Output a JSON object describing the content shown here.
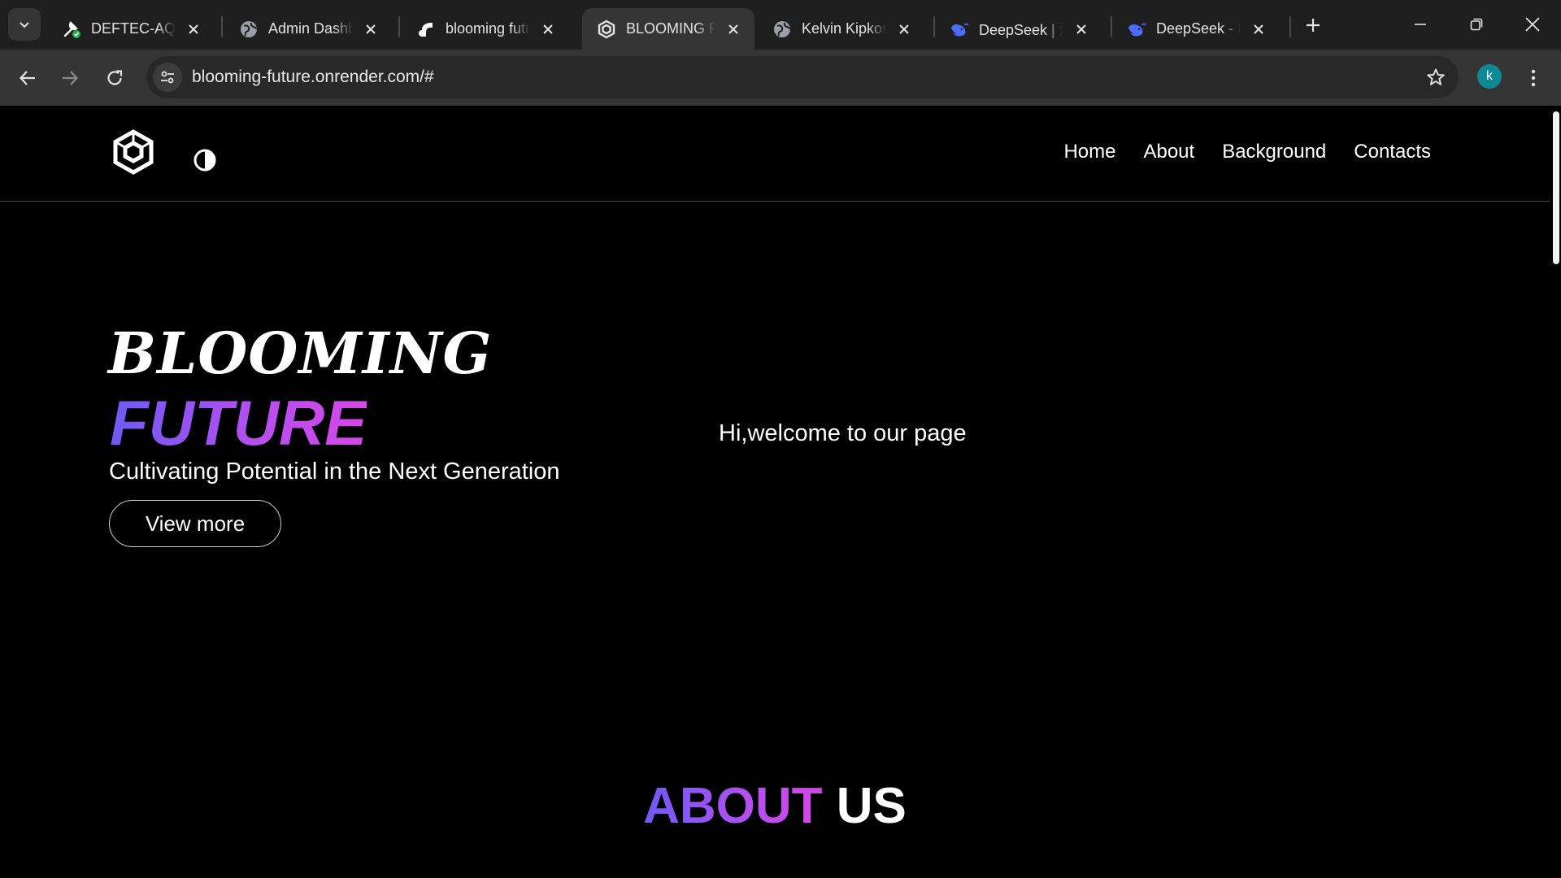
{
  "browser": {
    "tabs": [
      {
        "title": "DEFTEC-AQS",
        "icon": "wrench-check-icon",
        "active": false
      },
      {
        "title": "Admin Dashboard",
        "icon": "globe-icon",
        "active": false
      },
      {
        "title": "blooming future",
        "icon": "render-icon",
        "active": false
      },
      {
        "title": "BLOOMING FUTURE",
        "icon": "hexagon-logo-icon",
        "active": true
      },
      {
        "title": "Kelvin Kipkosgei",
        "icon": "globe-icon",
        "active": false
      },
      {
        "title": "DeepSeek | 深度求索",
        "icon": "deepseek-whale-icon",
        "active": false
      },
      {
        "title": "DeepSeek - Into the Unknown",
        "icon": "deepseek-whale-icon",
        "active": false
      }
    ],
    "url": "blooming-future.onrender.com/#",
    "profile_initial": "k",
    "accent_color": "#0e8a96"
  },
  "site": {
    "nav": {
      "items": [
        "Home",
        "About",
        "Background",
        "Contacts"
      ]
    },
    "hero": {
      "title_line1": "BLOOMING",
      "title_line2": "FUTURE",
      "subtitle": "Cultivating Potential in the Next Generation",
      "cta_label": "View more",
      "welcome": "Hi,welcome to our page"
    },
    "about": {
      "heading_part1": "ABOUT",
      "heading_part2": "US"
    },
    "colors": {
      "background": "#000000",
      "text": "#ffffff",
      "gradient_start": "#6e5af5",
      "gradient_end": "#d647e8"
    }
  }
}
